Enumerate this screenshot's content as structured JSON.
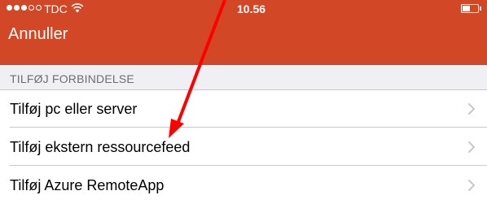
{
  "status_bar": {
    "carrier": "TDC",
    "time": "10.56"
  },
  "nav": {
    "cancel_label": "Annuller"
  },
  "section": {
    "header": "TILFØJ FORBINDELSE"
  },
  "items": [
    {
      "label": "Tilføj pc eller server"
    },
    {
      "label": "Tilføj ekstern ressourcefeed"
    },
    {
      "label": "Tilføj Azure RemoteApp"
    }
  ],
  "colors": {
    "topbar": "#d24726",
    "background": "#efeff4",
    "annotation_arrow": "#ff0000"
  },
  "icons": {
    "row_accessory": "chevron-right-icon",
    "signal": "signal-dots-icon",
    "wifi": "wifi-icon",
    "battery": "battery-icon"
  }
}
